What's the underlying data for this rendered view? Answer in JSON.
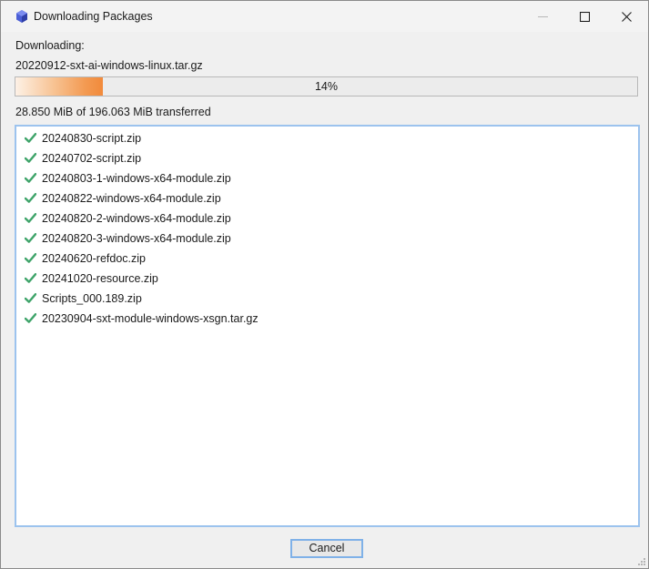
{
  "window": {
    "title": "Downloading Packages",
    "app_icon": "app-logo-icon",
    "controls": [
      "minimize-icon",
      "maximize-icon",
      "close-icon"
    ]
  },
  "status": {
    "label": "Downloading:",
    "current_file": "20220912-sxt-ai-windows-linux.tar.gz",
    "progress_percent": 14,
    "progress_text": "14%",
    "transferred": "28.850 MiB of 196.063 MiB transferred"
  },
  "completed_items": [
    {
      "label": "20240830-script.zip",
      "icon": "checkmark-icon"
    },
    {
      "label": "20240702-script.zip",
      "icon": "checkmark-icon"
    },
    {
      "label": "20240803-1-windows-x64-module.zip",
      "icon": "checkmark-icon"
    },
    {
      "label": "20240822-windows-x64-module.zip",
      "icon": "checkmark-icon"
    },
    {
      "label": "20240820-2-windows-x64-module.zip",
      "icon": "checkmark-icon"
    },
    {
      "label": "20240820-3-windows-x64-module.zip",
      "icon": "checkmark-icon"
    },
    {
      "label": "20240620-refdoc.zip",
      "icon": "checkmark-icon"
    },
    {
      "label": "20241020-resource.zip",
      "icon": "checkmark-icon"
    },
    {
      "label": "Scripts_000.189.zip",
      "icon": "checkmark-icon"
    },
    {
      "label": "20230904-sxt-module-windows-xsgn.tar.gz",
      "icon": "checkmark-icon"
    }
  ],
  "buttons": {
    "cancel_label": "Cancel"
  },
  "colors": {
    "progress_fill": "#f28a3b",
    "check": "#3fa46a",
    "focus_border": "#7fb1e8"
  }
}
